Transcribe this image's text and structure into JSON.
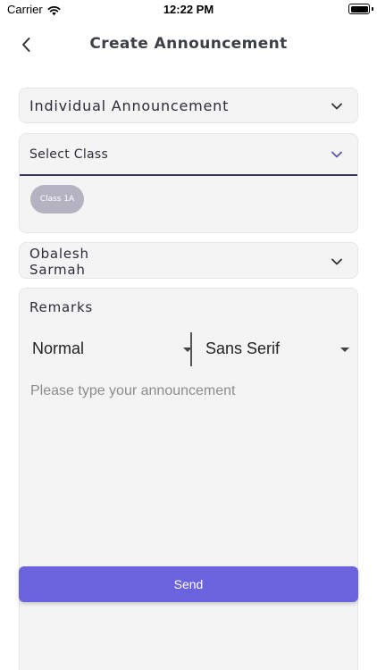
{
  "status_bar": {
    "carrier": "Carrier",
    "time": "12:22 PM"
  },
  "header": {
    "title": "Create Announcement"
  },
  "form": {
    "announcement_type": "Individual Announcement",
    "class_select_label": "Select Class",
    "selected_classes": [
      "Class 1A"
    ],
    "student_name": "Obalesh\nSarmah",
    "remarks_label": "Remarks"
  },
  "editor": {
    "size_value": "Normal",
    "font_value": "Sans Serif",
    "placeholder": "Please type your announcement"
  },
  "actions": {
    "send_label": "Send"
  },
  "colors": {
    "accent": "#6b63dd",
    "chip": "#b5b3c2",
    "field_bg": "#f4f4f4",
    "dropdown_chevron": "#5b57a6"
  },
  "icons": {
    "back": "chevron-left-icon",
    "dropdown": "chevron-down-icon",
    "wifi": "wifi-icon",
    "battery": "battery-icon"
  }
}
